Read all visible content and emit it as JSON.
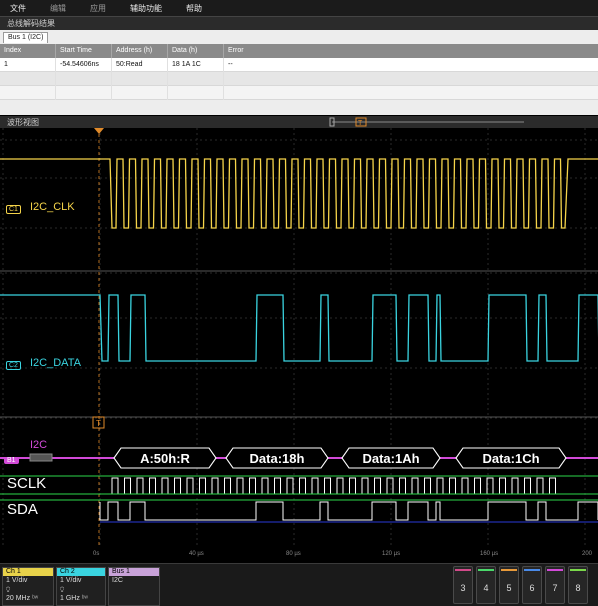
{
  "menu": {
    "items": [
      {
        "label": "文件",
        "enabled": true
      },
      {
        "label": "编辑",
        "enabled": false
      },
      {
        "label": "应用",
        "enabled": false
      },
      {
        "label": "辅助功能",
        "enabled": true
      },
      {
        "label": "帮助",
        "enabled": true
      }
    ]
  },
  "results": {
    "title": "总线解码结果",
    "tab": "Bus 1 (I2C)",
    "columns": [
      "Index",
      "Start Time",
      "Address (h)",
      "Data (h)",
      "Error"
    ],
    "rows": [
      [
        "1",
        "-54.54606ns",
        "50:Read",
        "18 1A 1C",
        "--"
      ]
    ]
  },
  "waveform": {
    "title": "波形视图",
    "ch1": {
      "badge": "C1",
      "name": "I2C_CLK",
      "color": "#f5d44a"
    },
    "ch2": {
      "badge": "C2",
      "name": "I2C_DATA",
      "color": "#3ad4e0"
    },
    "bus": {
      "badge": "B1",
      "protocol": "I2C",
      "color": "#d24ad8"
    },
    "trigger_marker": "T",
    "packets": [
      "A:50h:R",
      "Data:18h",
      "Data:1Ah",
      "Data:1Ch"
    ],
    "signals": [
      "SCLK",
      "SDA"
    ],
    "time_ticks": [
      "0s",
      "40 µs",
      "80 µs",
      "120 µs",
      "160 µs",
      "200"
    ]
  },
  "bottom": {
    "channels": [
      {
        "title": "Ch 1",
        "color": "#e8d24a",
        "scale": "1 V/div",
        "bandwidth": "20 MHz"
      },
      {
        "title": "Ch 2",
        "color": "#3ad4e0",
        "scale": "1 V/div",
        "bandwidth": "1 GHz"
      }
    ],
    "bus": {
      "title": "Bus 1",
      "color": "#c8a2d8",
      "protocol": "I2C"
    },
    "buttons": [
      {
        "label": "3",
        "color": "#d24a8a"
      },
      {
        "label": "4",
        "color": "#4ad86a"
      },
      {
        "label": "5",
        "color": "#e89a3a"
      },
      {
        "label": "6",
        "color": "#4a8ae8"
      },
      {
        "label": "7",
        "color": "#d24ad8"
      },
      {
        "label": "8",
        "color": "#7ad84a"
      }
    ]
  }
}
